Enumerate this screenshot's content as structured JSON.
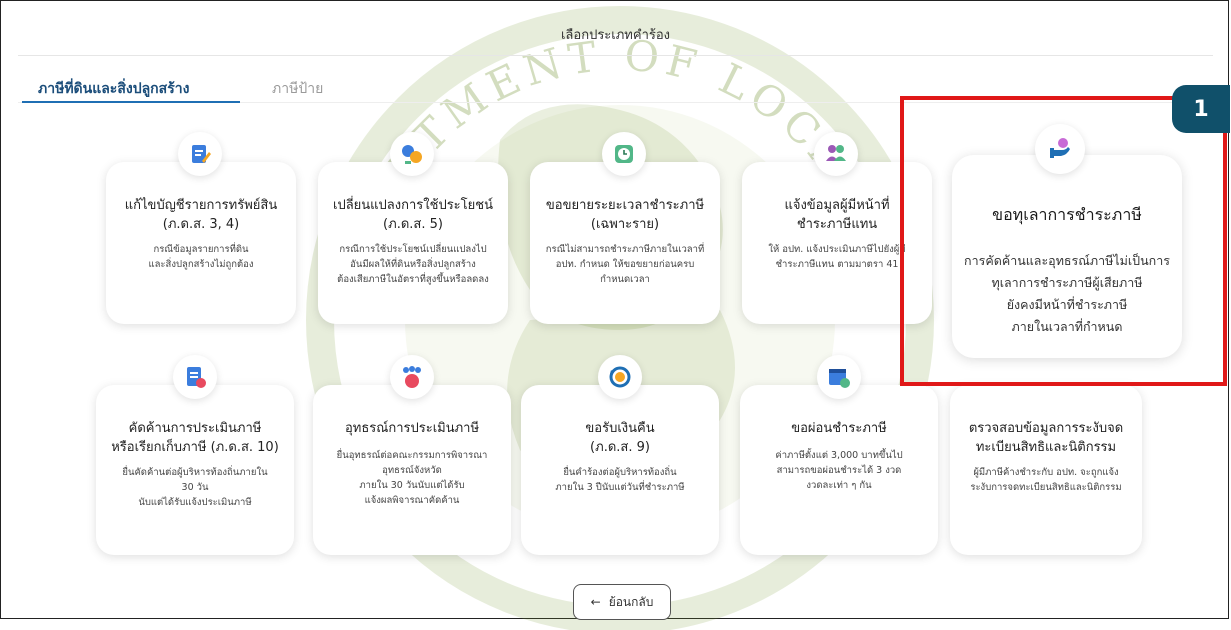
{
  "header": {
    "title": "เลือกประเภทคำร้อง"
  },
  "tabs": [
    {
      "label": "ภาษีที่ดินและสิ่งปลูกสร้าง",
      "active": true
    },
    {
      "label": "ภาษีป้าย",
      "active": false
    }
  ],
  "cards_row1": [
    {
      "icon": "edit-document-icon",
      "title": "แก้ไขบัญชีรายการทรัพย์สิน",
      "subtitle": "(ภ.ด.ส. 3, 4)",
      "desc": [
        "กรณีข้อมูลรายการที่ดิน",
        "และสิ่งปลูกสร้างไม่ถูกต้อง"
      ]
    },
    {
      "icon": "change-usage-icon",
      "title": "เปลี่ยนแปลงการใช้ประโยชน์",
      "subtitle": "(ภ.ด.ส. 5)",
      "desc": [
        "กรณีการใช้ประโยชน์เปลี่ยนแปลงไป",
        "อันมีผลให้ที่ดินหรือสิ่งปลูกสร้าง",
        "ต้องเสียภาษีในอัตราที่สูงขึ้นหรือลดลง"
      ]
    },
    {
      "icon": "clock-extension-icon",
      "title": "ขอขยายระยะเวลาชำระภาษี",
      "subtitle": "(เฉพาะราย)",
      "desc": [
        "กรณีไม่สามารถชำระภาษีภายในเวลาที่",
        "อปท. กำหนด ให้ขอขยายก่อนครบ",
        "กำหนดเวลา"
      ]
    },
    {
      "icon": "payer-info-icon",
      "title": "แจ้งข้อมูลผู้มีหน้าที่",
      "subtitle": "ชำระภาษีแทน",
      "desc": [
        "ให้ อปท. แจ้งประเมินภาษีไปยังผู้มี",
        "ชำระภาษีแทน ตามมาตรา 41"
      ]
    }
  ],
  "featured_card": {
    "icon": "hand-coin-icon",
    "title": "ขอทุเลาการชำระภาษี",
    "desc": [
      "การคัดค้านและอุทธรณ์ภาษีไม่เป็นการ",
      "ทุเลาการชำระภาษีผู้เสียภาษี",
      "ยังคงมีหน้าที่ชำระภาษี",
      "ภายในเวลาที่กำหนด"
    ]
  },
  "cards_row2": [
    {
      "icon": "objection-document-icon",
      "title": "คัดค้านการประเมินภาษี",
      "subtitle": "หรือเรียกเก็บภาษี (ภ.ด.ส. 10)",
      "desc": [
        "ยื่นคัดค้านต่อผู้บริหารท้องถิ่นภายใน",
        "30 วัน",
        "นับแต่ได้รับแจ้งประเมินภาษี"
      ]
    },
    {
      "icon": "committee-group-icon",
      "title": "อุทธรณ์การประเมินภาษี",
      "subtitle": "",
      "desc": [
        "ยื่นอุทธรณ์ต่อคณะกรรมการพิจารณา",
        "อุทธรณ์จังหวัด",
        "ภายใน 30 วันนับแต่ได้รับ",
        "แจ้งผลพิจารณาคัดค้าน"
      ]
    },
    {
      "icon": "refund-coin-icon",
      "title": "ขอรับเงินคืน",
      "subtitle": "(ภ.ด.ส. 9)",
      "desc": [
        "ยื่นคำร้องต่อผู้บริหารท้องถิ่น",
        "ภายใน 3 ปีนับแต่วันที่ชำระภาษี"
      ]
    },
    {
      "icon": "calendar-installment-icon",
      "title": "ขอผ่อนชำระภาษี",
      "subtitle": "",
      "desc": [
        "ค่าภาษีตั้งแต่ 3,000 บาทขึ้นไป",
        "สามารถขอผ่อนชำระได้ 3 งวด",
        "งวดละเท่า ๆ กัน"
      ]
    },
    {
      "icon": "registry-check-icon",
      "title": "ตรวจสอบข้อมูลการระงับจด",
      "subtitle": "ทะเบียนสิทธิและนิติกรรม",
      "desc": [
        "ผู้มีภาษีค้างชำระกับ อปท. จะถูกแจ้ง",
        "ระงับการจดทะเบียนสิทธิและนิติกรรม"
      ]
    }
  ],
  "annotation": {
    "step": "1",
    "highlight_color": "#e01818"
  },
  "back_button": {
    "label": "ย้อนกลับ",
    "icon": "arrow-left-icon"
  },
  "watermark": {
    "text": "DEPARTMENT OF LOCAL ADMINISTRATION"
  },
  "colors": {
    "accent": "#1f6fb4",
    "badge": "#10506a",
    "watermark": "#6e8f2a"
  }
}
